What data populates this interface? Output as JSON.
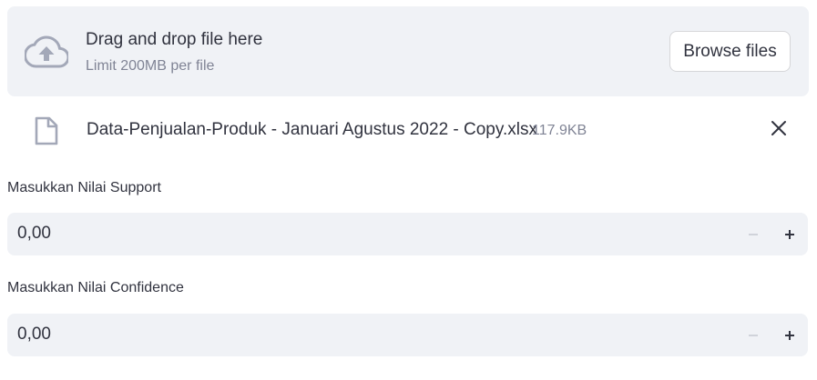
{
  "uploader": {
    "title": "Drag and drop file here",
    "limit": "Limit 200MB per file",
    "browse_label": "Browse files"
  },
  "file": {
    "name": "Data-Penjualan-Produk - Januari Agustus 2022 - Copy.xlsx",
    "size": "117.9KB"
  },
  "support": {
    "label": "Masukkan Nilai Support",
    "value": "0,00"
  },
  "confidence": {
    "label": "Masukkan Nilai Confidence",
    "value": "0,00"
  },
  "colors": {
    "panel_bg": "#f0f2f6",
    "text": "#31333f",
    "muted": "#808495",
    "icon": "#a3a8b8"
  },
  "icons": {
    "upload": "cloud-upload-icon",
    "file": "file-icon",
    "close": "close-icon",
    "minus": "minus-icon",
    "plus": "plus-icon"
  }
}
